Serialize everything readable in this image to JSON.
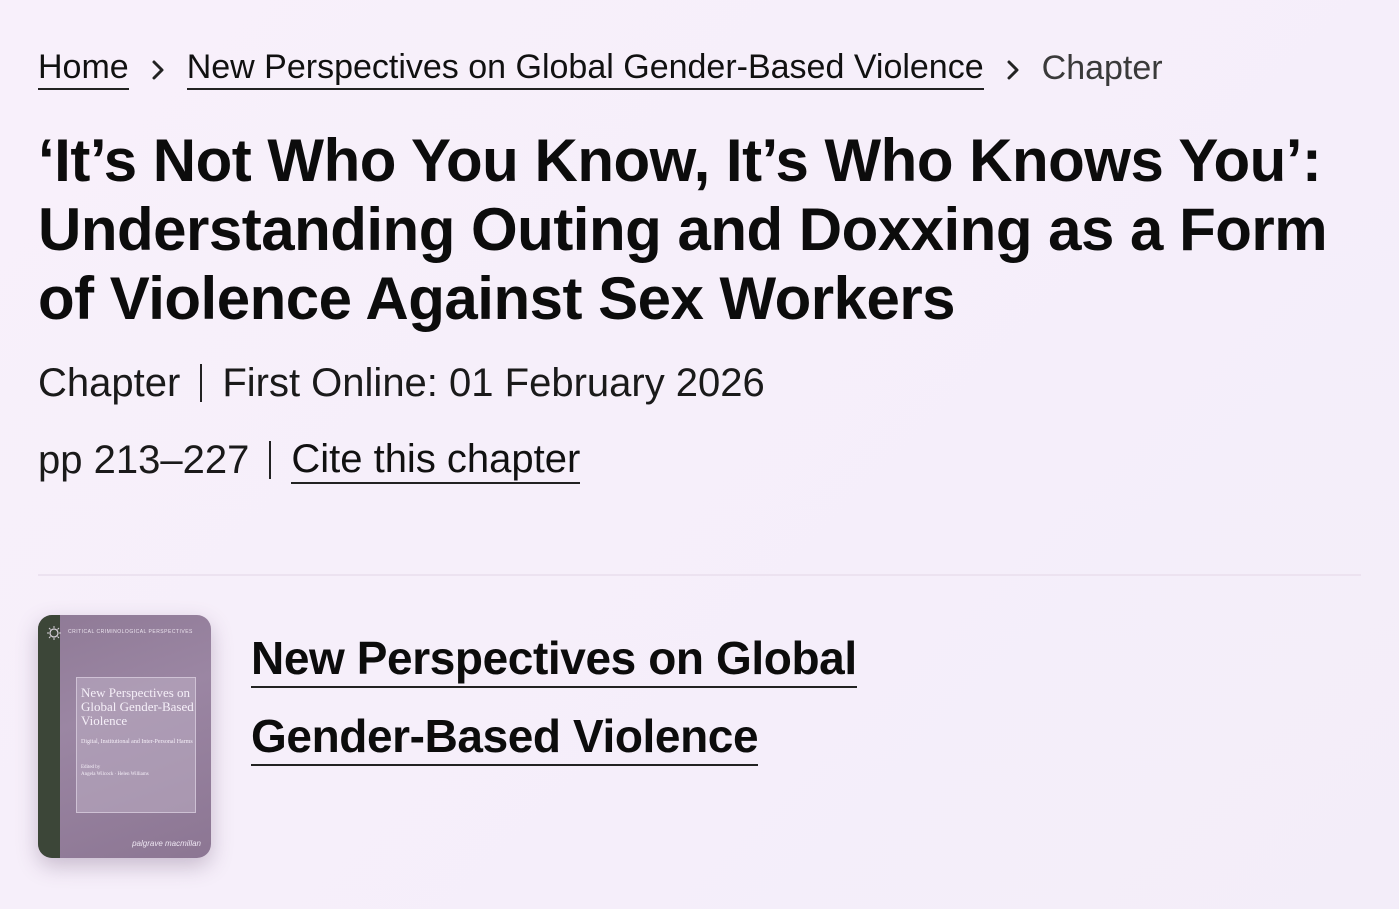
{
  "breadcrumb": {
    "items": [
      {
        "label": "Home"
      },
      {
        "label": "New Perspectives on Global Gender-Based Violence"
      },
      {
        "label": "Chapter"
      }
    ]
  },
  "chapter": {
    "title": "‘It’s Not Who You Know, It’s Who Knows You’: Understanding Outing and Doxxing as a Form of Violence Against Sex Workers",
    "type": "Chapter",
    "first_online": "First Online: 01 February 2026",
    "pages": "pp 213–227",
    "cite_label": "Cite this chapter"
  },
  "book": {
    "title": "New Perspectives on Global Gender-Based Violence",
    "cover": {
      "series": "CRITICAL CRIMINOLOGICAL PERSPECTIVES",
      "title": "New Perspectives on Global Gender-Based Violence",
      "subtitle": "Digital, Institutional and Inter-Personal Harms",
      "edited_by": "Edited by",
      "editors": "Angela Wilcock · Helen Williams",
      "publisher": "palgrave macmillan"
    }
  }
}
